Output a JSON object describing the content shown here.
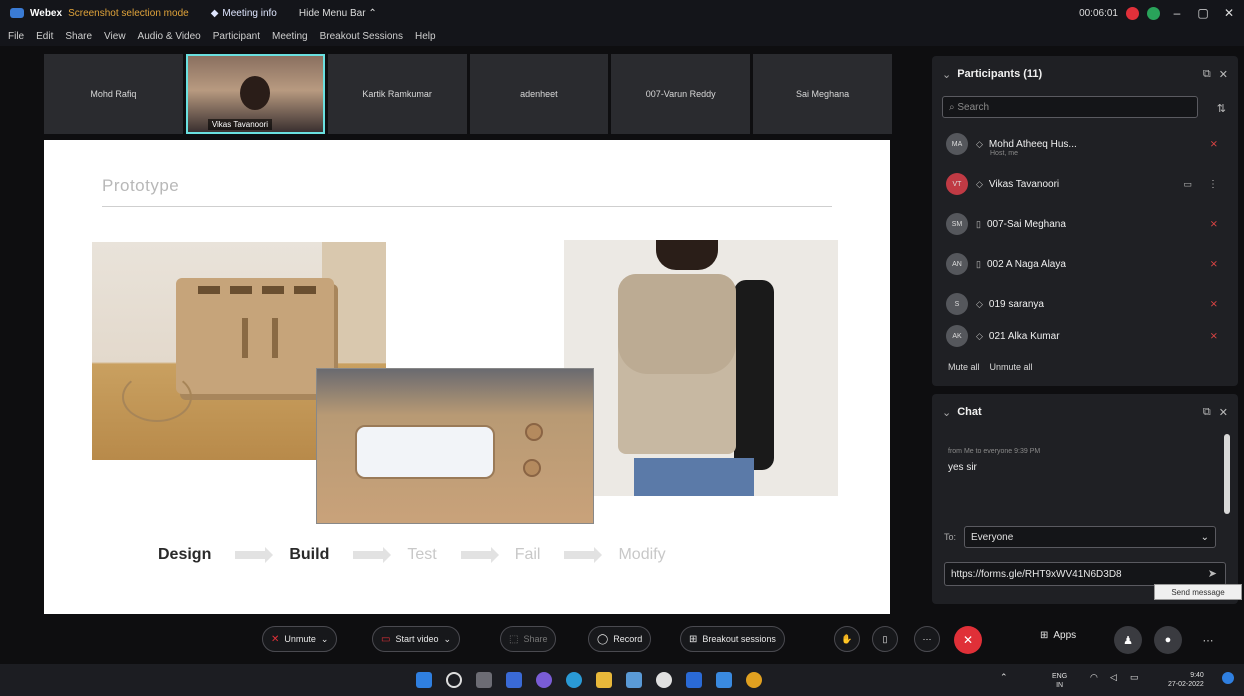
{
  "titlebar": {
    "app": "Webex",
    "status": "Screenshot selection mode",
    "meeting_info": "Meeting info",
    "hide_menu": "Hide Menu Bar",
    "timer": "00:06:01"
  },
  "menu": [
    "File",
    "Edit",
    "Share",
    "View",
    "Audio & Video",
    "Participant",
    "Meeting",
    "Breakout Sessions",
    "Help"
  ],
  "strip": {
    "tiles": [
      "Mohd Rafiq",
      "Vikas Tavanoori",
      "Kartik Ramkumar",
      "adenheet",
      "007-Varun Reddy",
      "Sai Meghana"
    ],
    "active_name": "Vikas Tavanoori"
  },
  "slide": {
    "title": "Prototype",
    "process": [
      "Design",
      "Build",
      "Test",
      "Fail",
      "Modify"
    ]
  },
  "participants": {
    "title": "Participants (11)",
    "search_placeholder": "Search",
    "rows": [
      {
        "initials": "MA",
        "name": "Mohd Atheeq Hus...",
        "sub": "Host, me"
      },
      {
        "initials": "VT",
        "name": "Vikas Tavanoori",
        "sub": ""
      },
      {
        "initials": "SM",
        "name": "007-Sai Meghana",
        "sub": ""
      },
      {
        "initials": "AN",
        "name": "002 A Naga Alaya",
        "sub": ""
      },
      {
        "initials": "S",
        "name": "019 saranya",
        "sub": ""
      },
      {
        "initials": "AK",
        "name": "021 Alka Kumar",
        "sub": ""
      }
    ],
    "mute_all": "Mute all",
    "unmute_all": "Unmute all"
  },
  "chat": {
    "title": "Chat",
    "meta": "from Me to everyone  9:39 PM",
    "message": "yes sir",
    "to_label": "To:",
    "to_value": "Everyone",
    "input_value": "https://forms.gle/RHT9xWV41N6D3D8",
    "tooltip": "Send message"
  },
  "controls": {
    "unmute": "Unmute",
    "start_video": "Start video",
    "share": "Share",
    "record": "Record",
    "breakout": "Breakout sessions",
    "apps": "Apps"
  },
  "taskbar": {
    "lang": "ENG",
    "region": "IN",
    "time": "9:40",
    "date": "27-02-2022"
  },
  "colors": {
    "accent_red": "#e03038",
    "accent_cyan": "#6ae0e0",
    "panel": "#1f2024"
  }
}
